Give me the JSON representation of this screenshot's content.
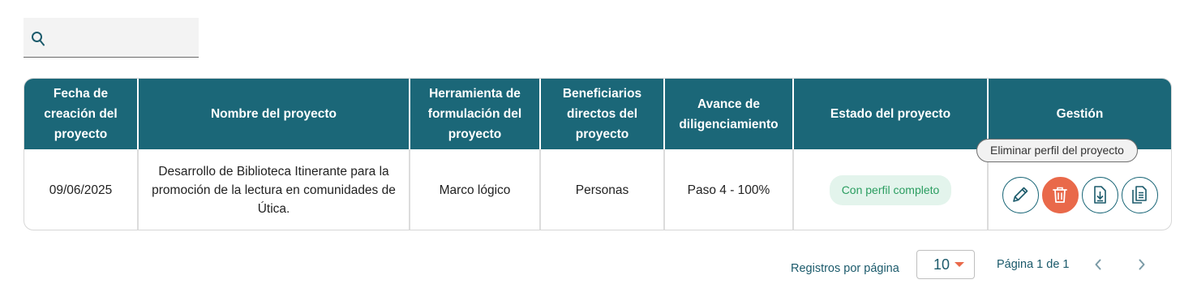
{
  "search": {
    "placeholder": "",
    "value": ""
  },
  "table": {
    "headers": [
      "Fecha de creación del proyecto",
      "Nombre del proyecto",
      "Herramienta de formulación del proyecto",
      "Beneficiarios directos del proyecto",
      "Avance de diligenciamiento",
      "Estado del proyecto",
      "Gestión"
    ],
    "rows": [
      {
        "fecha": "09/06/2025",
        "nombre": "Desarrollo de Biblioteca Itinerante para la promoción de la lectura en comunidades de Útica.",
        "herramienta": "Marco lógico",
        "beneficiarios": "Personas",
        "avance": "Paso 4 - 100%",
        "estado": "Con perfil completo"
      }
    ]
  },
  "actions": {
    "icons": [
      "edit-icon",
      "trash-icon",
      "download-icon",
      "copy-document-icon"
    ],
    "tooltip": "Eliminar perfil del proyecto"
  },
  "pagination": {
    "per_page_label": "Registros por página",
    "per_page_value": "10",
    "page_info": "Página 1 de 1"
  },
  "colors": {
    "header_bg": "#1b6778",
    "delete_accent": "#e9694a",
    "status_bg": "#e3f4ec",
    "status_text": "#2a9d60"
  }
}
